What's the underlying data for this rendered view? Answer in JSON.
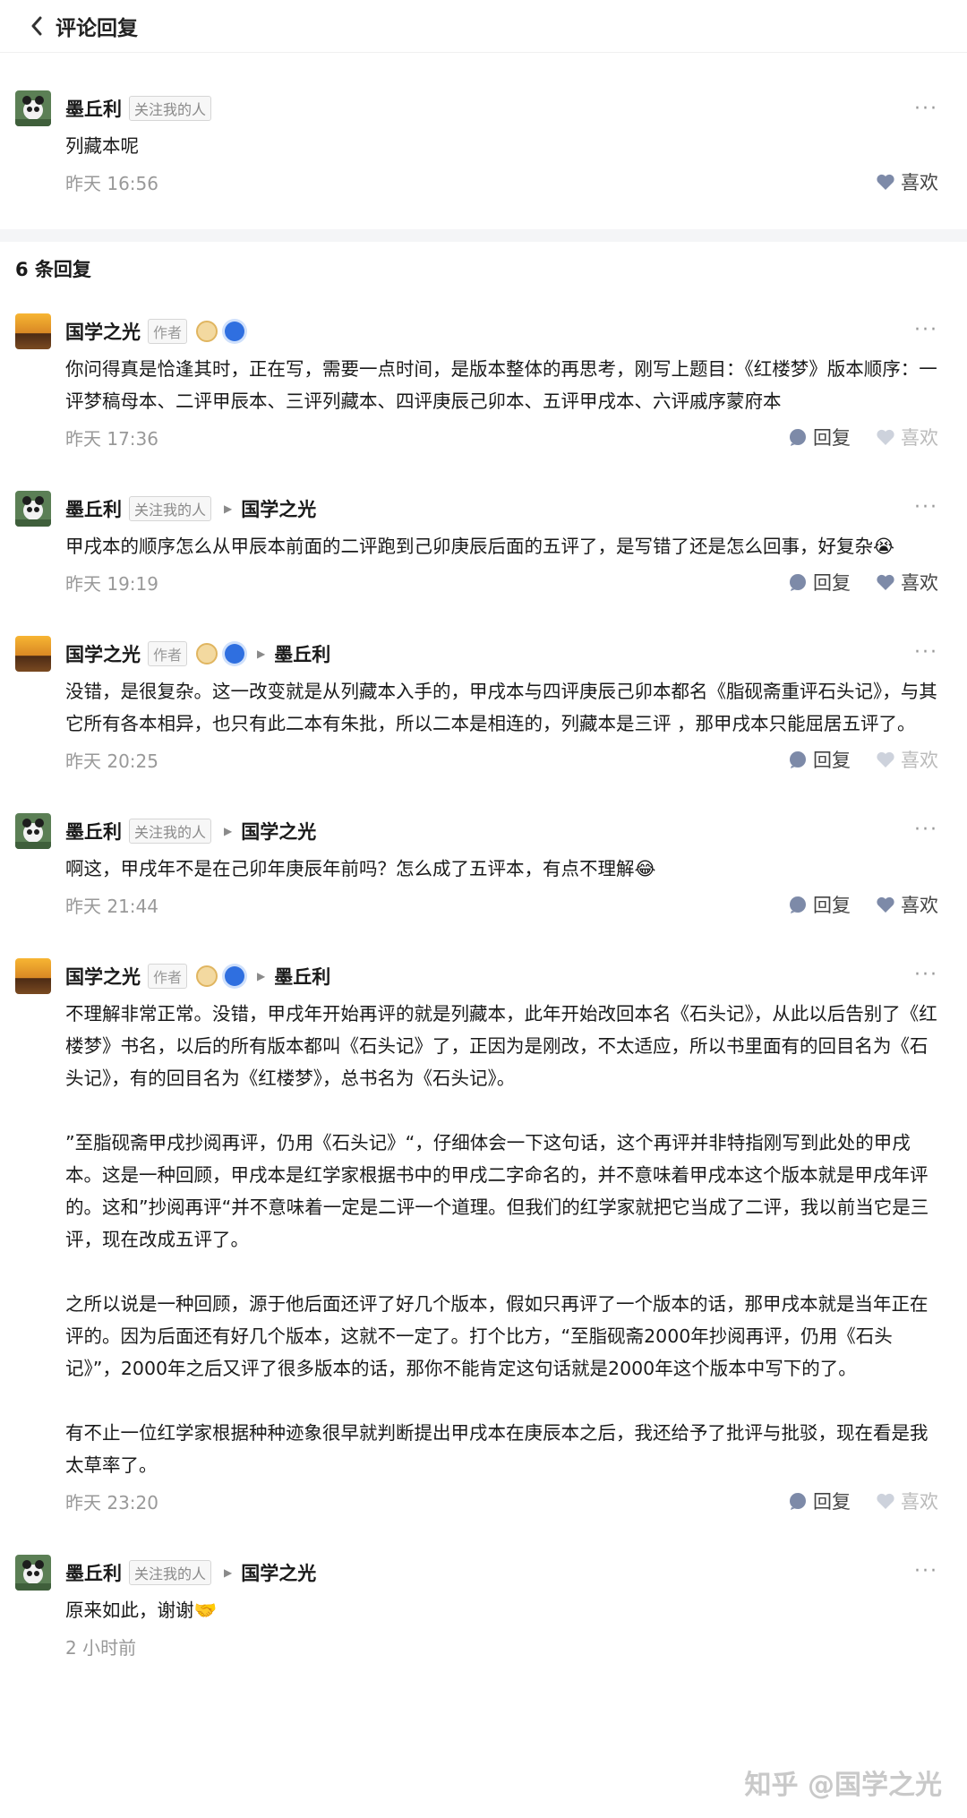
{
  "header": {
    "title": "评论回复"
  },
  "root_comment": {
    "author": "墨丘利",
    "tag": "关注我的人",
    "text": "列藏本呢",
    "time": "昨天 16:56",
    "like_label": "喜欢",
    "more": "···"
  },
  "replies_count": "6 条回复",
  "labels": {
    "reply": "回复",
    "like": "喜欢",
    "author_tag": "作者",
    "follow_tag": "关注我的人",
    "more": "···"
  },
  "replies": [
    {
      "author": "国学之光",
      "reply_to": "",
      "paragraphs": [
        "你问得真是恰逢其时，正在写，需要一点时间，是版本整体的再思考，刚写上题目：《红楼梦》版本顺序：一评梦稿母本、二评甲辰本、三评列藏本、四评庚辰己卯本、五评甲戌本、六评戚序蒙府本"
      ],
      "time": "昨天 17:36"
    },
    {
      "author": "墨丘利",
      "reply_to": "国学之光",
      "paragraphs": [
        "甲戌本的顺序怎么从甲辰本前面的二评跑到己卯庚辰后面的五评了，是写错了还是怎么回事，好复杂😭"
      ],
      "time": "昨天 19:19"
    },
    {
      "author": "国学之光",
      "reply_to": "墨丘利",
      "paragraphs": [
        "没错，是很复杂。这一改变就是从列藏本入手的，甲戌本与四评庚辰己卯本都名《脂砚斋重评石头记》，与其它所有各本相异，也只有此二本有朱批，所以二本是相连的，列藏本是三评 ，那甲戌本只能屈居五评了。"
      ],
      "time": "昨天 20:25"
    },
    {
      "author": "墨丘利",
      "reply_to": "国学之光",
      "paragraphs": [
        "啊这，甲戌年不是在己卯年庚辰年前吗？怎么成了五评本，有点不理解😂"
      ],
      "time": "昨天 21:44"
    },
    {
      "author": "国学之光",
      "reply_to": "墨丘利",
      "paragraphs": [
        "不理解非常正常。没错，甲戌年开始再评的就是列藏本，此年开始改回本名《石头记》，从此以后告别了《红楼梦》书名，以后的所有版本都叫《石头记》了，正因为是刚改，不太适应，所以书里面有的回目名为《石头记》，有的回目名为《红楼梦》，总书名为《石头记》。",
        "”至脂砚斋甲戌抄阅再评，仍用《石头记》“，仔细体会一下这句话，这个再评并非特指刚写到此处的甲戌本。这是一种回顾，甲戌本是红学家根据书中的甲戌二字命名的，并不意味着甲戌本这个版本就是甲戌年评的。这和”抄阅再评“并不意味着一定是二评一个道理。但我们的红学家就把它当成了二评，我以前当它是三评，现在改成五评了。",
        "之所以说是一种回顾，源于他后面还评了好几个版本，假如只再评了一个版本的话，那甲戌本就是当年正在评的。因为后面还有好几个版本，这就不一定了。打个比方，“至脂砚斋2000年抄阅再评，仍用《石头记》”，2000年之后又评了很多版本的话，那你不能肯定这句话就是2000年这个版本中写下的了。",
        "有不止一位红学家根据种种迹象很早就判断提出甲戌本在庚辰本之后，我还给予了批评与批驳，现在看是我太草率了。"
      ],
      "time": "昨天 23:20"
    },
    {
      "author": "墨丘利",
      "reply_to": "国学之光",
      "paragraphs": [
        "原来如此，谢谢🤝"
      ],
      "time": "2 小时前"
    }
  ],
  "watermark": "知乎 @国学之光"
}
